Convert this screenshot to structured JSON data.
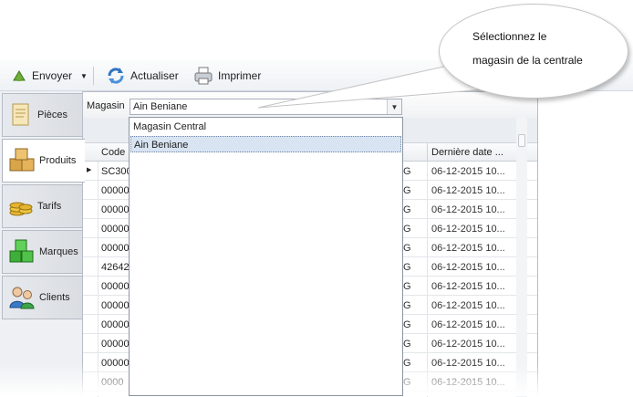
{
  "toolbar": {
    "envoyer": "Envoyer",
    "actualiser": "Actualiser",
    "imprimer": "Imprimer"
  },
  "sidebar": {
    "items": [
      {
        "label": "Pièces",
        "icon": "document-icon"
      },
      {
        "label": "Produits",
        "icon": "boxes-icon"
      },
      {
        "label": "Tarifs",
        "icon": "coins-icon"
      },
      {
        "label": "Marques",
        "icon": "cubes-icon"
      },
      {
        "label": "Clients",
        "icon": "users-icon"
      }
    ],
    "active": "Produits"
  },
  "filter": {
    "label": "Magasin",
    "selected": "Ain Beniane",
    "options": [
      "Magasin Central",
      "Ain Beniane"
    ]
  },
  "grid": {
    "col_code": "Code",
    "col_date": "Dernière date ...",
    "rows": [
      {
        "code": "SC300",
        "g": "G",
        "date": "06-12-2015 10..."
      },
      {
        "code": "00000",
        "g": "G",
        "date": "06-12-2015 10..."
      },
      {
        "code": "00000",
        "g": "G",
        "date": "06-12-2015 10..."
      },
      {
        "code": "00000",
        "g": "G",
        "date": "06-12-2015 10..."
      },
      {
        "code": "00000",
        "g": "G",
        "date": "06-12-2015 10..."
      },
      {
        "code": "42642",
        "g": "G",
        "date": "06-12-2015 10..."
      },
      {
        "code": "00000",
        "g": "G",
        "date": "06-12-2015 10..."
      },
      {
        "code": "00000",
        "g": "G",
        "date": "06-12-2015 10..."
      },
      {
        "code": "00000",
        "g": "G",
        "date": "06-12-2015 10..."
      },
      {
        "code": "00000",
        "g": "G",
        "date": "06-12-2015 10..."
      },
      {
        "code": "00000",
        "g": "G",
        "date": "06-12-2015 10..."
      },
      {
        "code": "0000",
        "g": "G",
        "date": "06-12-2015 10..."
      }
    ]
  },
  "callout": {
    "line1": "Sélectionnez le",
    "line2": "magasin de la centrale"
  },
  "colors": {
    "selection": "#d9e4f3",
    "border": "#b7bdc6",
    "toolbar_bg": "#eef1f5"
  }
}
